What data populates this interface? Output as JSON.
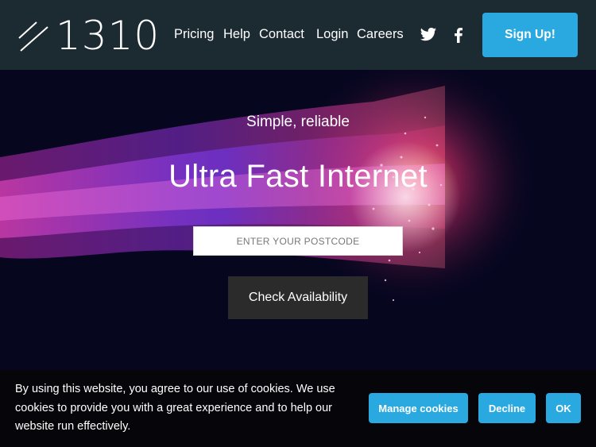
{
  "header": {
    "logo_text": "1310",
    "nav": [
      {
        "label": "Pricing"
      },
      {
        "label": "Help"
      },
      {
        "label": "Contact"
      },
      {
        "label": "Login"
      },
      {
        "label": "Careers"
      }
    ],
    "social": [
      "twitter-icon",
      "facebook-icon"
    ],
    "signup_label": "Sign Up!"
  },
  "hero": {
    "subtitle": "Simple, reliable",
    "title": "Ultra Fast Internet",
    "postcode_placeholder": "ENTER YOUR POSTCODE",
    "check_label": "Check Availability"
  },
  "cookie_banner": {
    "text": "By using this website, you agree to our use of cookies. We use cookies to provide you with a great experience and to help our website run effectively.",
    "manage_label": "Manage cookies",
    "decline_label": "Decline",
    "ok_label": "OK"
  },
  "colors": {
    "header_bg": "#1c2b32",
    "accent": "#29a9e0",
    "button_dark": "#2b2b2b",
    "cookie_bg": "#06060a"
  }
}
